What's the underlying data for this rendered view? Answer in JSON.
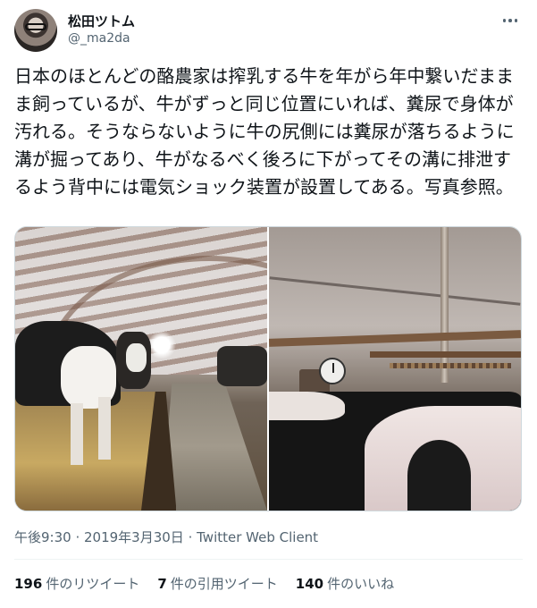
{
  "user": {
    "display_name": "松田ツトム",
    "handle": "@_ma2da"
  },
  "tweet": {
    "text": "日本のほとんどの酪農家は搾乳する牛を年がら年中繋いだままま飼っているが、牛がずっと同じ位置にいれば、糞尿で身体が汚れる。そうならないように牛の尻側には糞尿が落ちるように溝が掘ってあり、牛がなるべく後ろに下がってその溝に排泄するよう背中には電気ショック装置が設置してある。写真参照。",
    "time": "午後9:30",
    "separator1": " · ",
    "date": "2019年3月30日",
    "separator2": " · ",
    "client": "Twitter Web Client"
  },
  "stats": {
    "retweets": {
      "count": "196",
      "label": "件のリツイート"
    },
    "quotes": {
      "count": "7",
      "label": "件の引用ツイート"
    },
    "likes": {
      "count": "140",
      "label": "件のいいね"
    }
  },
  "icons": {
    "more": "more-dots-icon"
  }
}
